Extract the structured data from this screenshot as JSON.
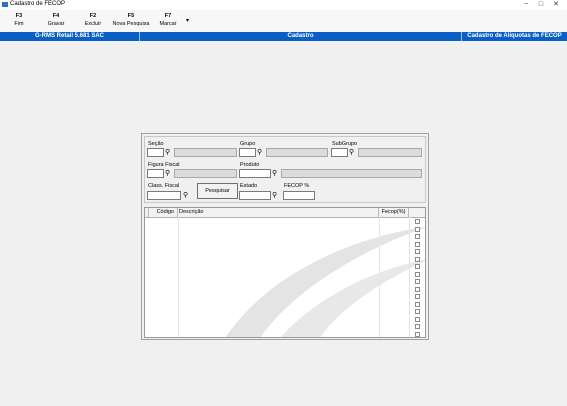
{
  "window": {
    "title": "Cadastro de FECOP",
    "controls": [
      "−",
      "□",
      "✕"
    ]
  },
  "toolbar": {
    "buttons": [
      {
        "key": "F3",
        "label": "Fim"
      },
      {
        "key": "F4",
        "label": "Gravar"
      },
      {
        "key": "F2",
        "label": "Excluir"
      },
      {
        "key": "F5",
        "label": "Nova Pesquisa"
      },
      {
        "key": "F7",
        "label": "Marcar"
      }
    ]
  },
  "statusbar": {
    "app": "G-RMS Retail 5.681 SAC",
    "section": "Cadastro",
    "screen": "Cadastro de Alíquotas de FECOP"
  },
  "filters": {
    "secao": {
      "label": "Seção",
      "value": "",
      "desc": ""
    },
    "grupo": {
      "label": "Grupo",
      "value": "",
      "desc": ""
    },
    "subgrupo": {
      "label": "SubGrupo",
      "value": "",
      "desc": ""
    },
    "figura_fiscal": {
      "label": "Figura Fiscal",
      "value": "",
      "desc": ""
    },
    "produto": {
      "label": "Produto",
      "value": "",
      "desc": ""
    },
    "class_fiscal": {
      "label": "Class. Fiscal",
      "value": ""
    },
    "estado": {
      "label": "Estado",
      "value": ""
    },
    "fecop_pct": {
      "label": "FECOP %",
      "value": ""
    },
    "search_button": "Pesquisar"
  },
  "grid": {
    "columns": [
      "Código",
      "Descrição",
      "Fecop(%)"
    ]
  },
  "icons": {
    "search": "binoculars-icon"
  },
  "colors": {
    "status_bar": "#0a5fc6",
    "app_icon": "#2a6fd1"
  }
}
